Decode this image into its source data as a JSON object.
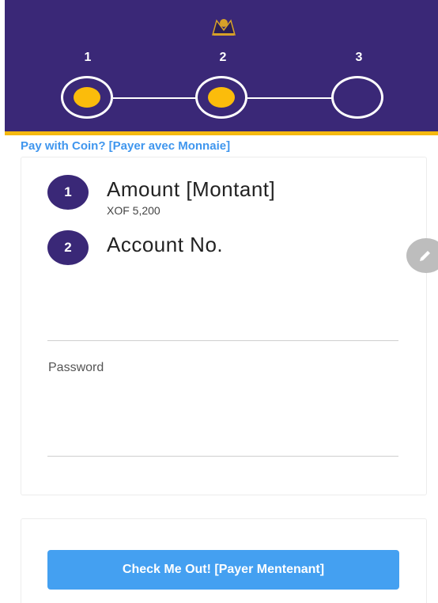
{
  "stepper": {
    "steps": [
      {
        "number": "1",
        "state": "complete"
      },
      {
        "number": "2",
        "state": "complete"
      },
      {
        "number": "3",
        "state": "pending"
      }
    ]
  },
  "coin_link": "Pay with Coin? [Payer avec Monnaie]",
  "form": {
    "amount": {
      "badge": "1",
      "title": "Amount [Montant]",
      "value": "XOF 5,200"
    },
    "account": {
      "badge": "2",
      "title": "Account No."
    },
    "password": {
      "label": "Password"
    }
  },
  "actions": {
    "checkout_label": "Check Me Out! [Payer Mentenant]"
  },
  "colors": {
    "header": "#3a2877",
    "accent_yellow": "#fbbc0b",
    "link_blue": "#3f96ee",
    "button_blue": "#44a0f1"
  },
  "icons": {
    "logo": "brand-logo-icon",
    "edit": "pencil-icon"
  }
}
